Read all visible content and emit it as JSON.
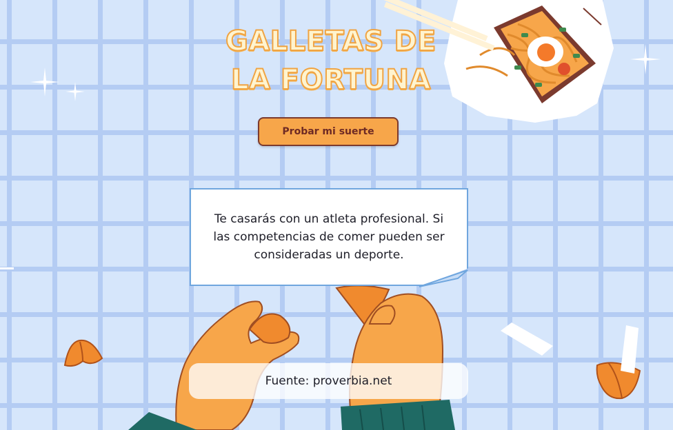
{
  "page": {
    "title_line1": "GALLETAS DE",
    "title_line2": "LA FORTUNA",
    "button_label": "Probar mi suerte",
    "fortune_text": "Te casarás con un atleta profesional. Si las competencias de comer pueden ser consideradas un deporte.",
    "source_text": "Fuente: proverbia.net"
  },
  "colors": {
    "background": "#d6e6fb",
    "grid": "#b4ccf3",
    "accent_orange": "#f7a64a",
    "button_border": "#7b3a2e",
    "title_fill": "#fff4cf",
    "title_stroke": "#f0a443"
  },
  "icons": [
    "noodle-box-illustration",
    "sparkle-icon",
    "fortune-cookie-icon",
    "hand-illustration",
    "paper-slip-icon"
  ]
}
